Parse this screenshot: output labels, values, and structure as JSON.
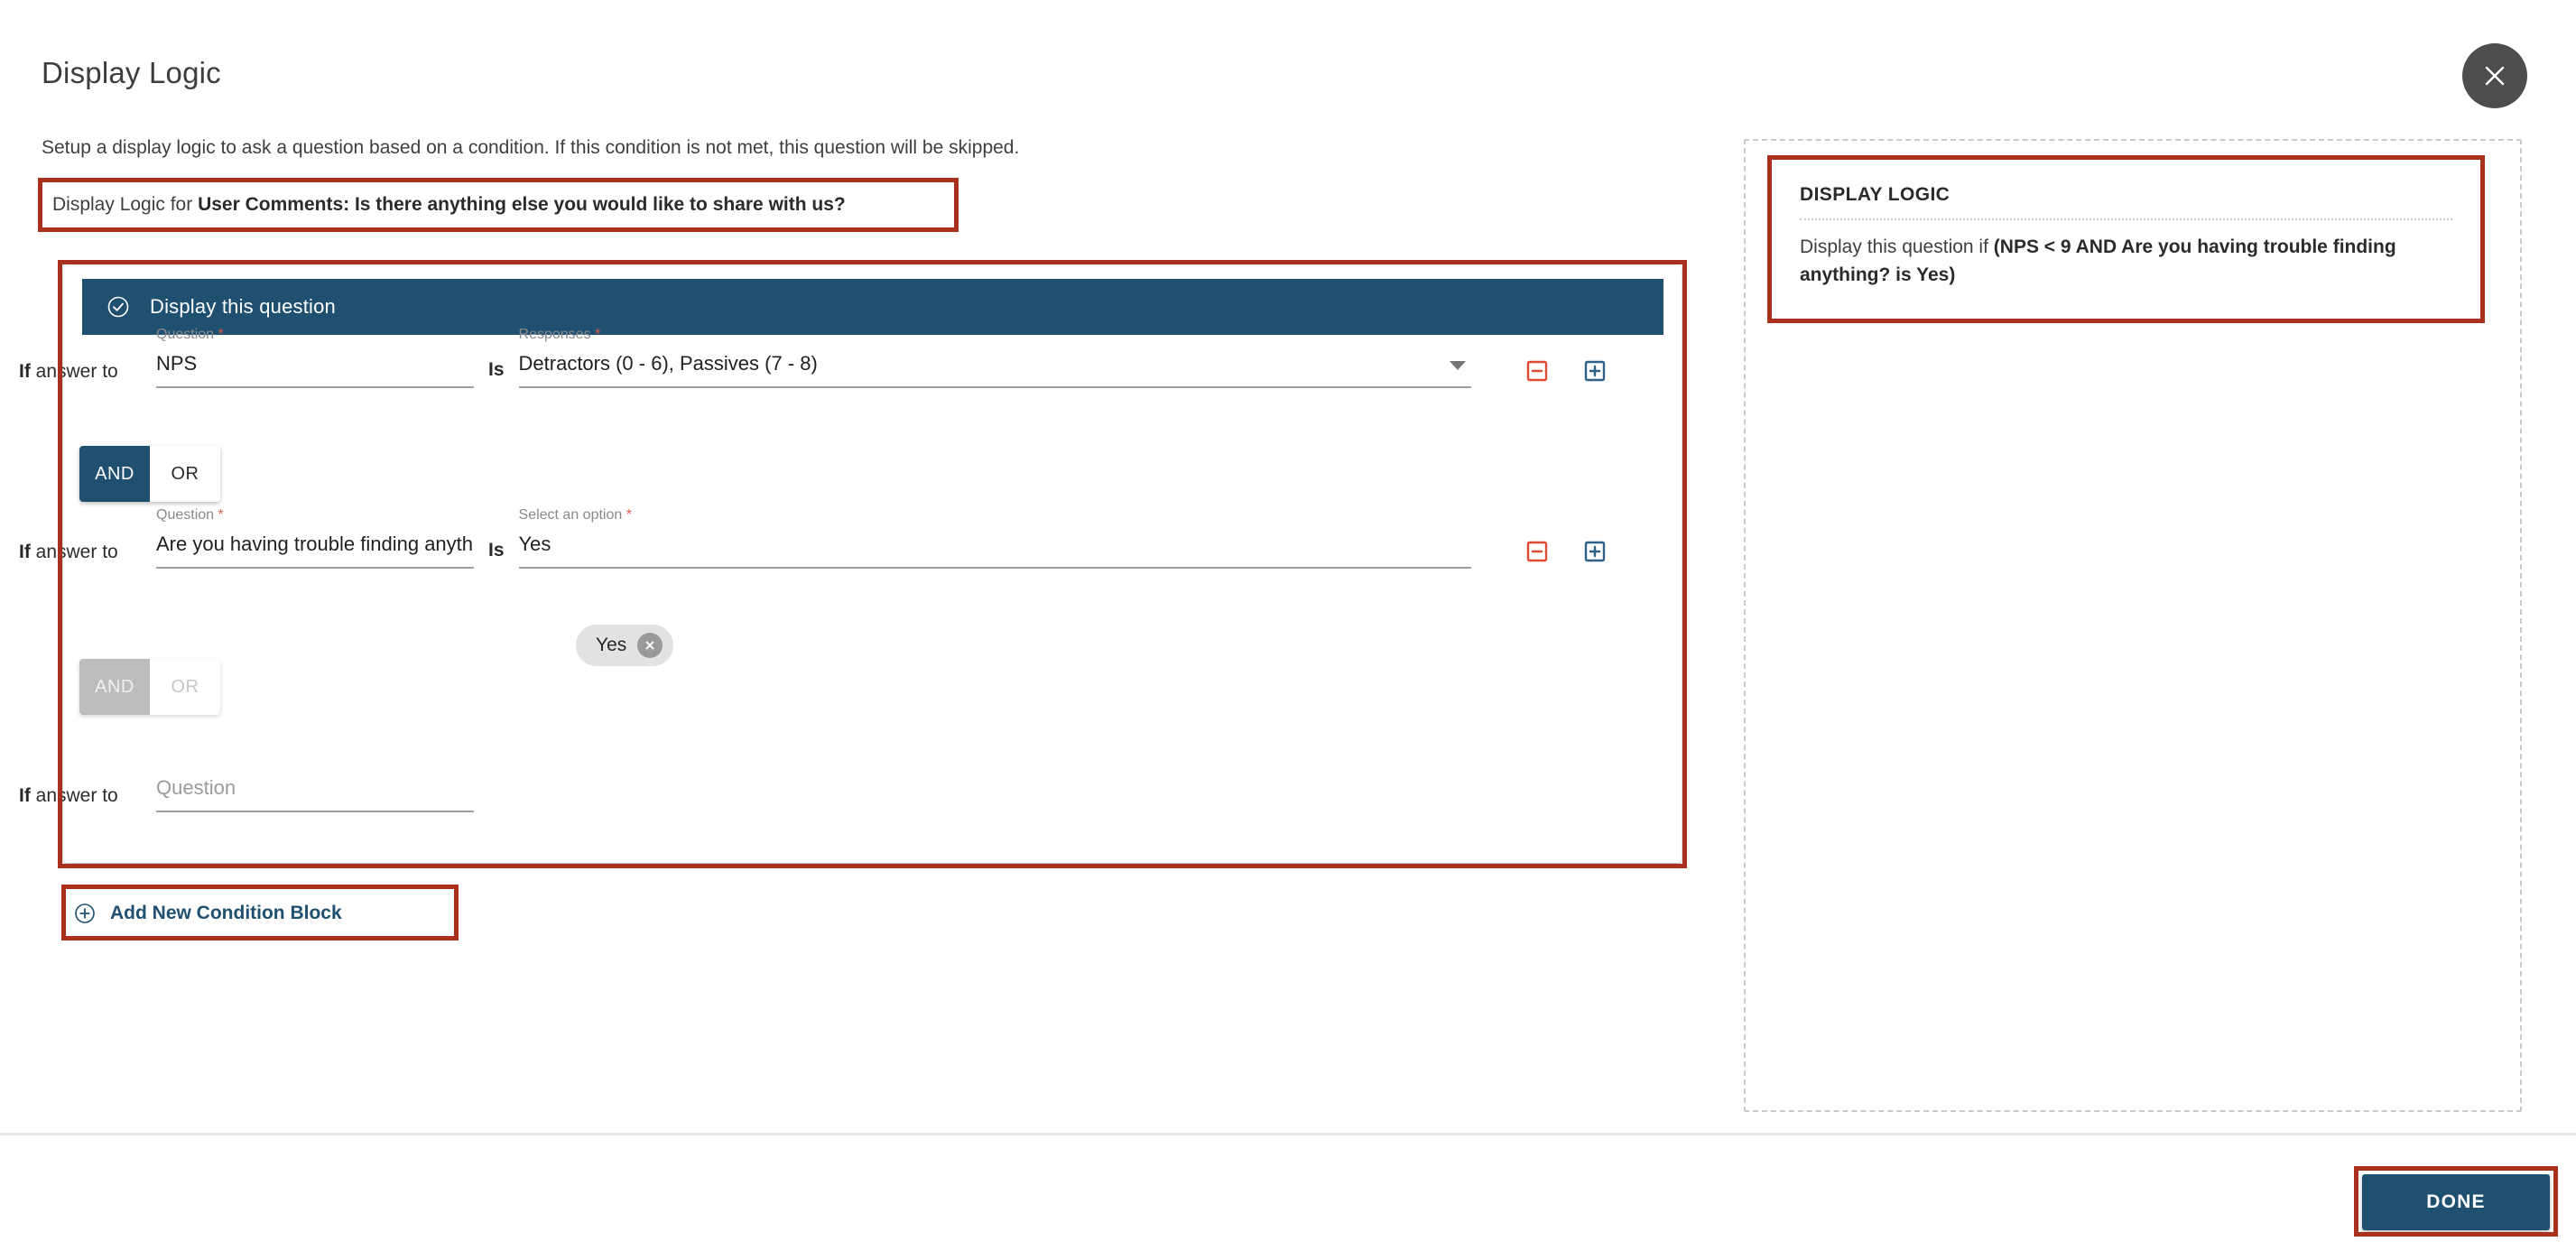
{
  "header": {
    "title": "Display Logic",
    "close_icon": "close-icon",
    "subtitle": "Setup a display logic to ask a question based on a condition. If this condition is not met, this question will be skipped.",
    "for_prefix": "Display Logic for ",
    "for_question": "User Comments: Is there anything else you would like to share with us?"
  },
  "condition_block": {
    "header_label": "Display this question",
    "header_icon": "check-circle-icon",
    "rows": [
      {
        "if_bold": "If",
        "if_rest": " answer to",
        "question_label": "Question",
        "question_required": "*",
        "question_value": "NPS",
        "operator": "Is",
        "value_label": "Responses",
        "value_required": "*",
        "value_value": "Detractors (0 - 6), Passives (7 - 8)",
        "has_caret": true,
        "remove_icon": "minus-square-icon",
        "add_icon": "plus-square-icon"
      },
      {
        "if_bold": "If",
        "if_rest": " answer to",
        "question_label": "Question",
        "question_required": "*",
        "question_value": "Are you having trouble finding anything?",
        "operator": "Is",
        "value_label": "Select an option",
        "value_required": "*",
        "value_value": "Yes",
        "has_caret": false,
        "remove_icon": "minus-square-icon",
        "add_icon": "plus-square-icon"
      },
      {
        "if_bold": "If",
        "if_rest": " answer to",
        "question_placeholder": "Question"
      }
    ],
    "toggles": [
      {
        "and_label": "AND",
        "or_label": "OR",
        "selected": "AND",
        "disabled": false
      },
      {
        "and_label": "AND",
        "or_label": "OR",
        "selected": "AND",
        "disabled": true
      }
    ],
    "chip": {
      "label": "Yes",
      "remove_icon": "chip-remove-icon"
    }
  },
  "add_condition_block": {
    "label": "Add New Condition Block",
    "icon": "plus-circle-icon"
  },
  "summary_panel": {
    "title": "DISPLAY LOGIC",
    "text_prefix": "Display this question if ",
    "text_bold": "(NPS < 9 AND Are you having trouble finding anything? is Yes)"
  },
  "footer": {
    "done_label": "DONE"
  },
  "colors": {
    "accent": "#1f5070",
    "annotation": "#a8301d",
    "remove_icon": "#e04b34",
    "add_icon": "#2d6188",
    "chip_bg": "#e2e2e2",
    "close_bg": "#4d4d4d"
  }
}
